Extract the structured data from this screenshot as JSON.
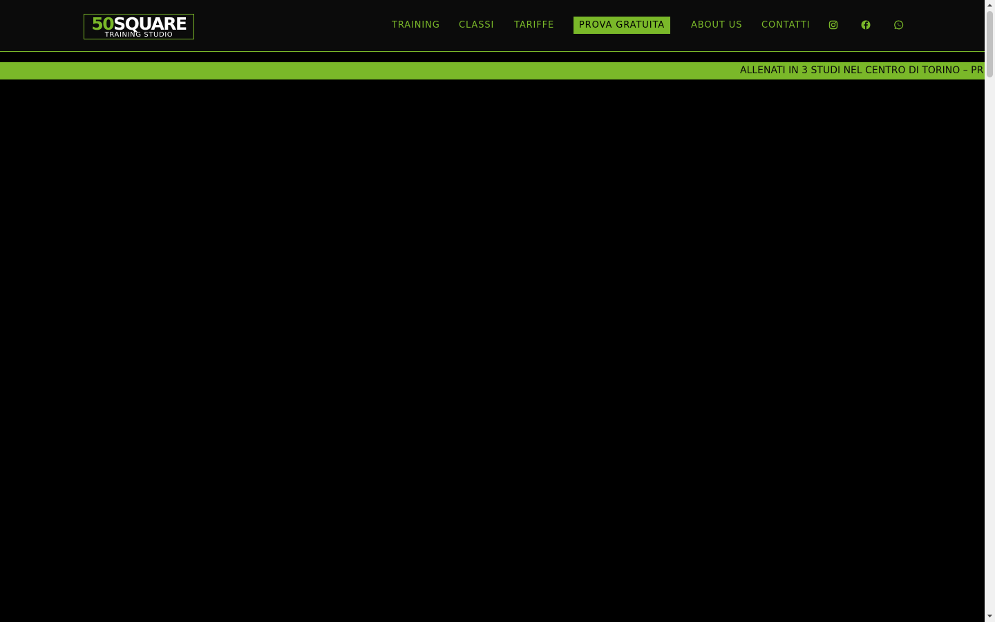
{
  "logo": {
    "number": "50",
    "word": "SQUARE",
    "tagline": "TRAINING STUDIO"
  },
  "nav": {
    "items": [
      {
        "label": "TRAINING"
      },
      {
        "label": "CLASSI"
      },
      {
        "label": "TARIFFE"
      },
      {
        "label": "PROVA GRATUITA"
      },
      {
        "label": "ABOUT US"
      },
      {
        "label": "CONTATTI"
      }
    ],
    "social": [
      "instagram-icon",
      "facebook-icon",
      "whatsapp-icon"
    ]
  },
  "ticker": {
    "text": "ALLENATI IN 3 STUDI NEL CENTRO DI TORINO – PR"
  },
  "colors": {
    "accent": "#7ab829",
    "header_bg": "#0b0b0b",
    "page_bg": "#000000"
  }
}
